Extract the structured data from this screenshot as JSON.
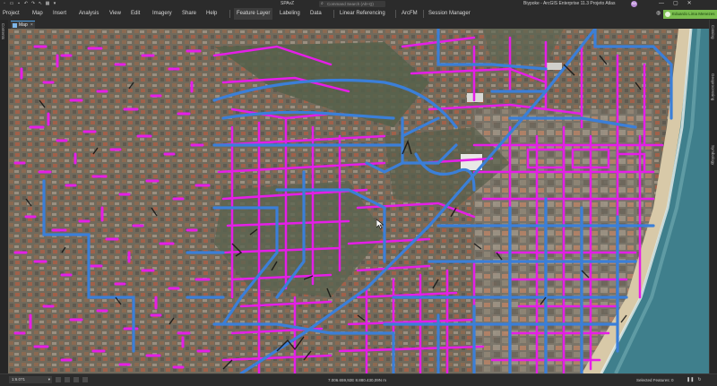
{
  "titlebar": {
    "document_title": "SPAvZ",
    "search_placeholder": "Command Search (Alt+Q)",
    "app_title": "Biypoke - ArcGIS Enterprise 11.3 Projeto Atlas",
    "avatar_initials": "BA",
    "window_buttons": [
      "—",
      "▢",
      "✕"
    ]
  },
  "ribbon": {
    "tabs": [
      "Project",
      "Map",
      "Insert",
      "Analysis",
      "View",
      "Edit",
      "Imagery",
      "Share",
      "Help"
    ],
    "context_tabs": [
      "Feature Layer",
      "Labeling",
      "Data"
    ],
    "extra_tabs": [
      "Linear Referencing",
      "ArcFM",
      "Session Manager"
    ],
    "signed_in_user": "Eduardo Lima Menezes"
  },
  "map_view": {
    "tab_label": "Map",
    "left_panel_label": "Contents",
    "right_panel_labels": [
      "Catalog",
      "Geoprocessing",
      "Symbology"
    ]
  },
  "statusbar": {
    "scale": "1:6.071",
    "coordinates": "7.006.659,92E 8.880.430,09N m",
    "selected_features": "Selected Features: 0"
  },
  "colors": {
    "network_magenta": "#e51ee8",
    "network_blue": "#3b7fd8",
    "signin_green": "#7bbf4f"
  }
}
